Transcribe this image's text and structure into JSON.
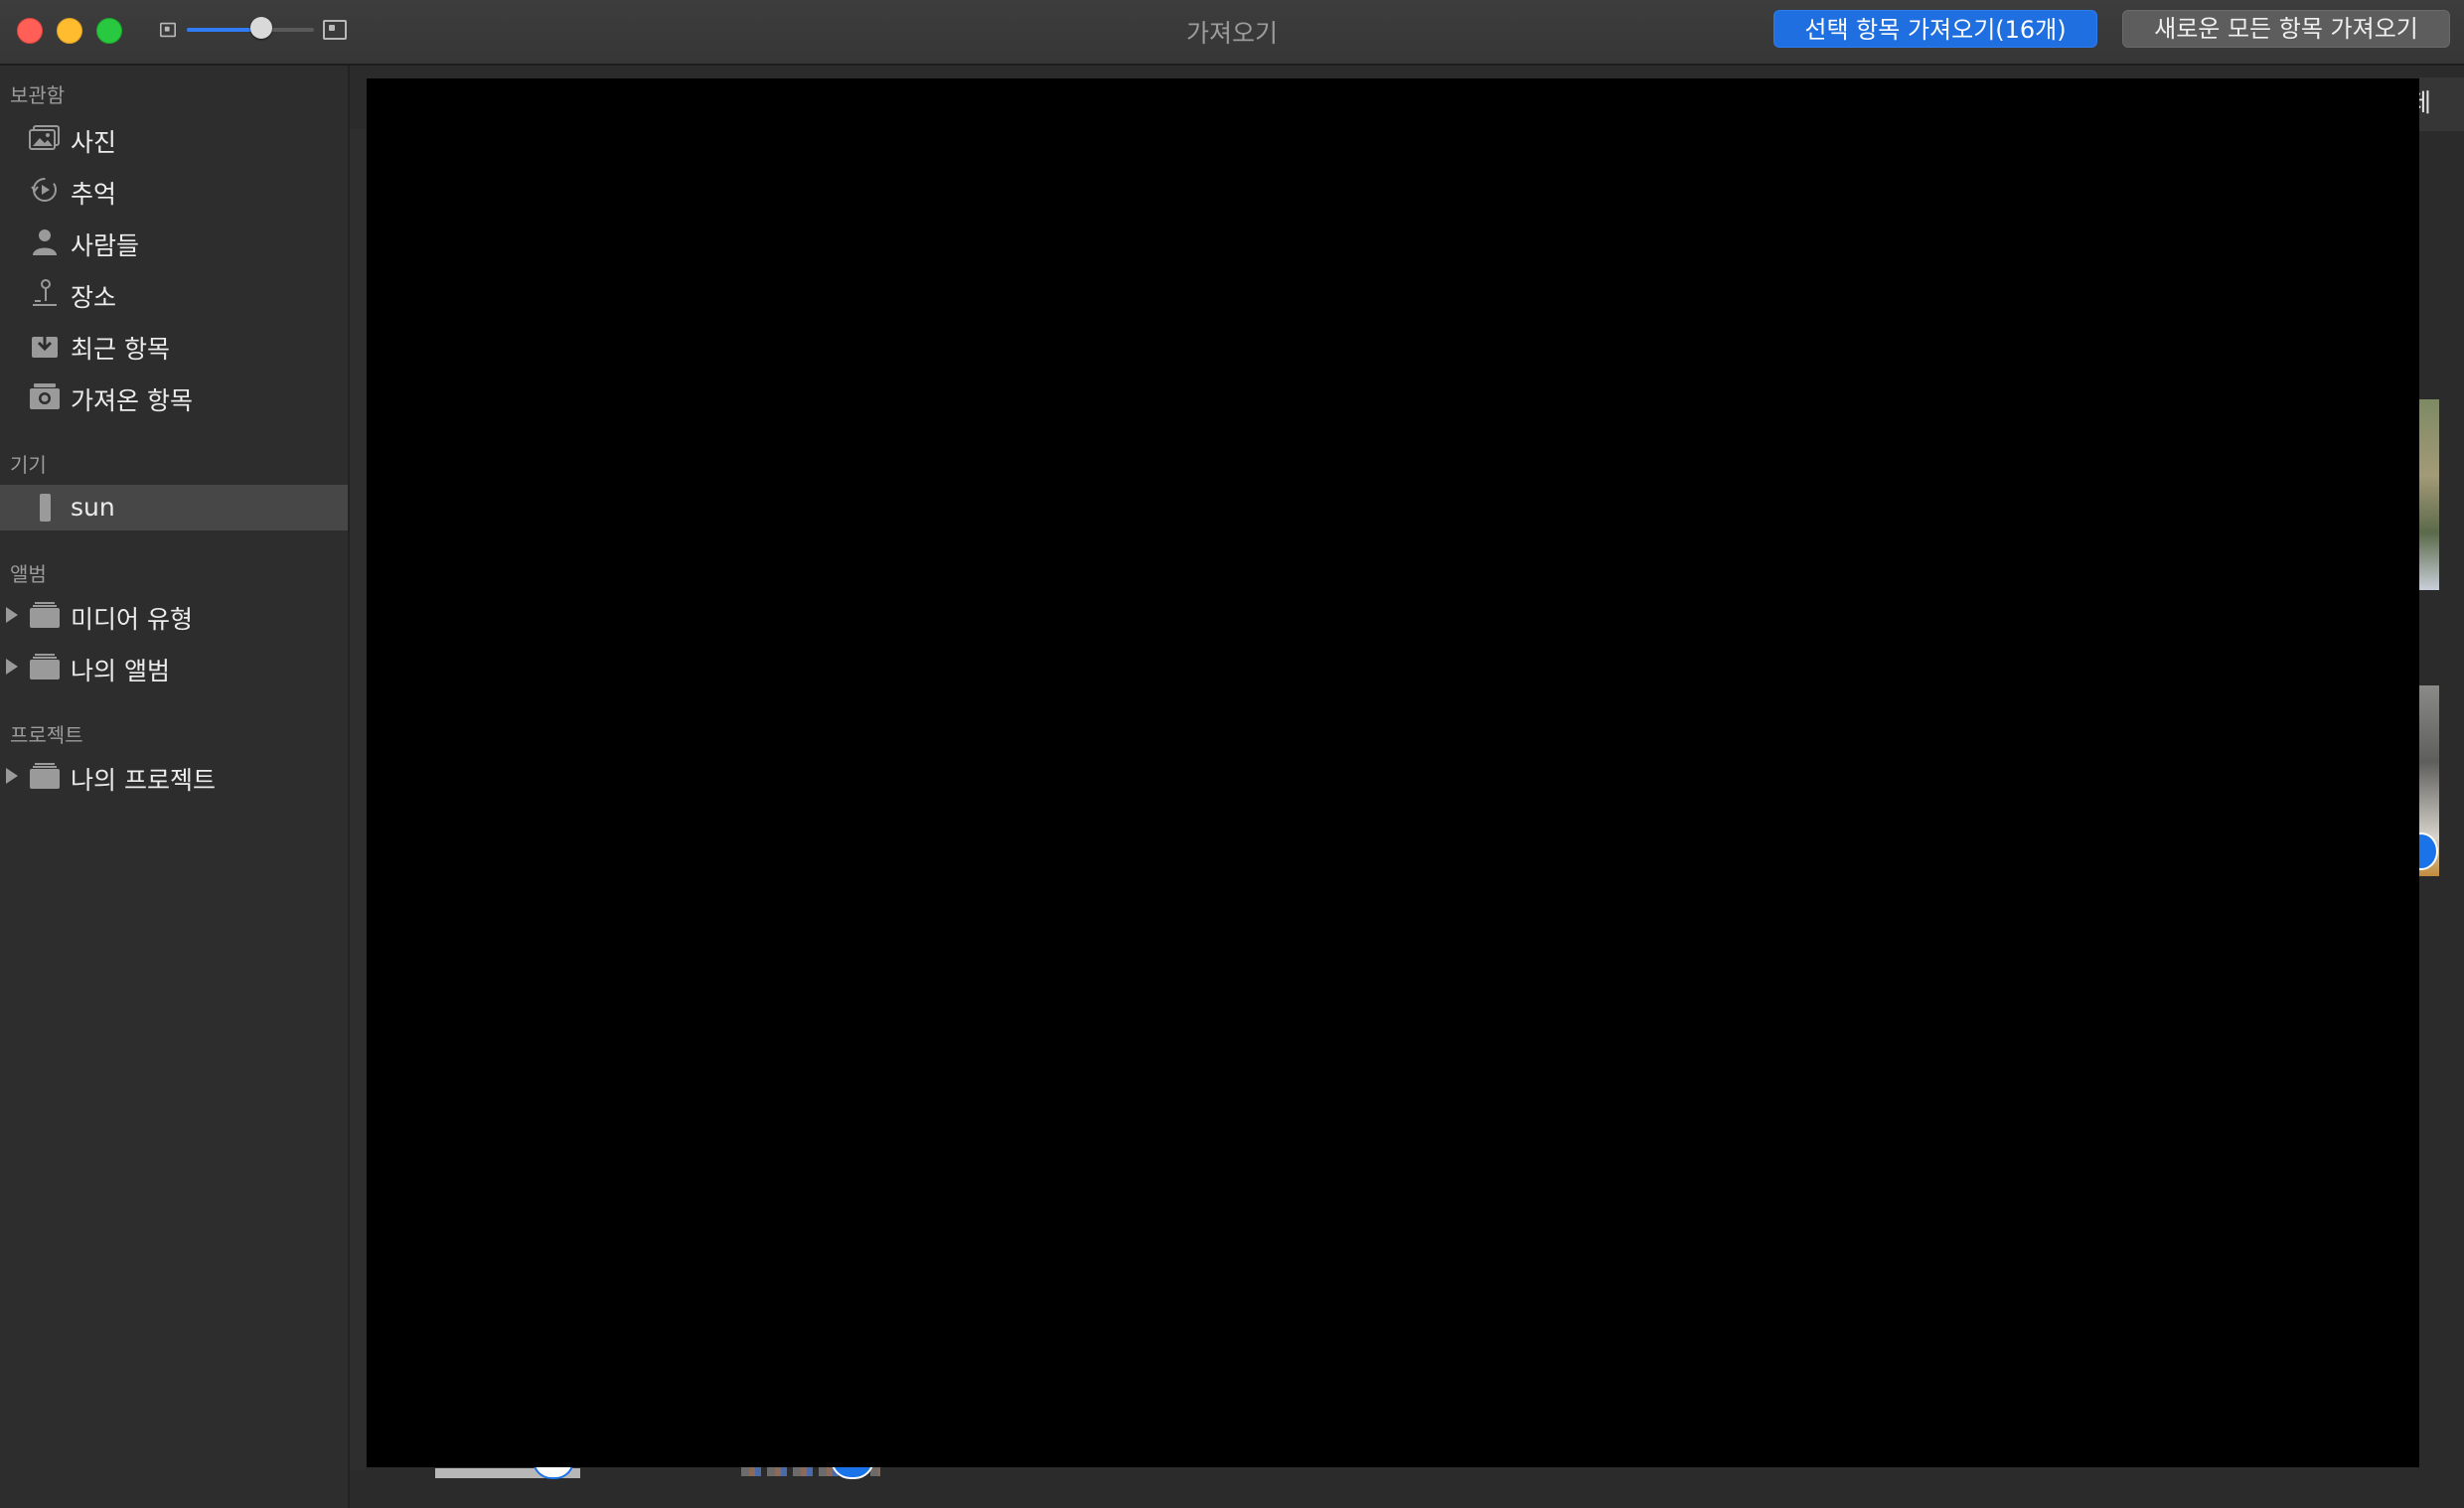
{
  "window": {
    "title": "가져오기",
    "zoom_level": 0.6
  },
  "toolbar": {
    "import_selected_label": "선택 항목 가져오기(16개)",
    "import_all_new_label": "새로운 모든 항목 가져오기"
  },
  "sidebar": {
    "library_header": "보관함",
    "library_items": [
      {
        "label": "사진",
        "icon": "photos-icon"
      },
      {
        "label": "추억",
        "icon": "memories-icon"
      },
      {
        "label": "사람들",
        "icon": "people-icon"
      },
      {
        "label": "장소",
        "icon": "places-icon"
      },
      {
        "label": "최근 항목",
        "icon": "recents-icon"
      },
      {
        "label": "가져온 항목",
        "icon": "imports-icon"
      }
    ],
    "devices_header": "기기",
    "device": {
      "label": "sun",
      "icon": "iphone-icon",
      "selected": true
    },
    "albums_header": "앨범",
    "album_items": [
      {
        "label": "미디어 유형",
        "icon": "folder-icon"
      },
      {
        "label": "나의 앨범",
        "icon": "folder-icon"
      }
    ],
    "projects_header": "프로젝트",
    "project_items": [
      {
        "label": "나의 프로젝트",
        "icon": "folder-icon"
      }
    ]
  },
  "main": {
    "delete_label_fragment": "제"
  },
  "colors": {
    "accent": "#1f6fe0",
    "titlebar": "#3a3a3a",
    "sidebar_bg": "#2d2d2d",
    "selected_row": "#474747"
  }
}
